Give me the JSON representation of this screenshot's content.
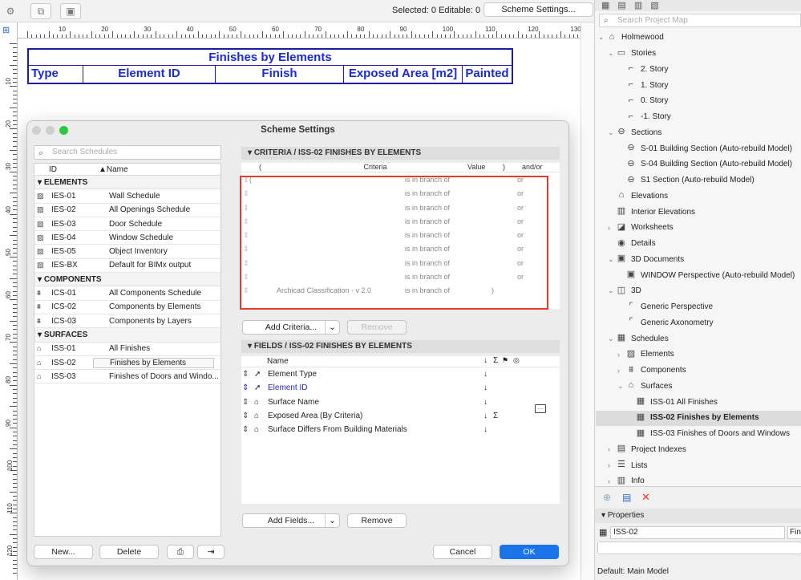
{
  "toolbar": {
    "selection_info": "Selected: 0  Editable: 0",
    "scheme_settings_button": "Scheme Settings..."
  },
  "ruler": {
    "h_labels": [
      "10",
      "20",
      "30",
      "40",
      "50",
      "60",
      "70",
      "80",
      "90",
      "100",
      "110",
      "120",
      "130"
    ],
    "v_labels": [
      "10",
      "20",
      "30",
      "40",
      "50",
      "60",
      "70",
      "80",
      "90",
      "100",
      "110",
      "120"
    ]
  },
  "schedule": {
    "title": "Finishes by Elements",
    "columns": [
      "Type",
      "Element ID",
      "Finish",
      "Exposed Area  [m2]",
      "Painted"
    ]
  },
  "dialog": {
    "title": "Scheme Settings",
    "search_placeholder": "Search Schedules",
    "list_header_id": "ID",
    "list_header_name": "▲Name",
    "groups": [
      {
        "label": "ELEMENTS",
        "icon": "hatch-icon",
        "items": [
          {
            "id": "IES-01",
            "name": "Wall Schedule"
          },
          {
            "id": "IES-02",
            "name": "All Openings Schedule"
          },
          {
            "id": "IES-03",
            "name": "Door Schedule"
          },
          {
            "id": "IES-04",
            "name": "Window Schedule"
          },
          {
            "id": "IES-05",
            "name": "Object Inventory"
          },
          {
            "id": "IES-BX",
            "name": "Default for BIMx output"
          }
        ]
      },
      {
        "label": "COMPONENTS",
        "icon": "component-icon",
        "items": [
          {
            "id": "ICS-01",
            "name": "All Components Schedule"
          },
          {
            "id": "ICS-02",
            "name": "Components by Elements"
          },
          {
            "id": "ICS-03",
            "name": "Components by Layers"
          }
        ]
      },
      {
        "label": "SURFACES",
        "icon": "surface-brush-icon",
        "items": [
          {
            "id": "ISS-01",
            "name": "All Finishes"
          },
          {
            "id": "ISS-02",
            "name": "Finishes by Elements",
            "selected": true
          },
          {
            "id": "ISS-03",
            "name": "Finishes of Doors and Windo..."
          }
        ]
      }
    ],
    "buttons": {
      "new": "New...",
      "delete": "Delete",
      "cancel": "Cancel",
      "ok": "OK"
    },
    "criteria": {
      "section_title": "CRITERIA / ISS-02 FINISHES BY ELEMENTS",
      "headers": {
        "open": "(",
        "criteria": "Criteria",
        "value": "Value",
        "close": ")",
        "andor": "and/or"
      },
      "rows": [
        {
          "open": "(",
          "criteria": "",
          "op": "is in branch of",
          "close": "",
          "andor": "or"
        },
        {
          "open": "",
          "criteria": "",
          "op": "is in branch of",
          "close": "",
          "andor": "or"
        },
        {
          "open": "",
          "criteria": "",
          "op": "is in branch of",
          "close": "",
          "andor": "or"
        },
        {
          "open": "",
          "criteria": "",
          "op": "is in branch of",
          "close": "",
          "andor": "or"
        },
        {
          "open": "",
          "criteria": "",
          "op": "is in branch of",
          "close": "",
          "andor": "or"
        },
        {
          "open": "",
          "criteria": "",
          "op": "is in branch of",
          "close": "",
          "andor": "or"
        },
        {
          "open": "",
          "criteria": "",
          "op": "is in branch of",
          "close": "",
          "andor": "or"
        },
        {
          "open": "",
          "criteria": "",
          "op": "is in branch of",
          "close": "",
          "andor": "or"
        },
        {
          "open": "",
          "criteria": "Archicad Classification - v 2.0",
          "op": "is in branch of",
          "close": ")",
          "andor": ""
        }
      ],
      "add_button": "Add Criteria...",
      "remove_button": "Remove"
    },
    "fields": {
      "section_title": "FIELDS / ISS-02 FINISHES BY ELEMENTS",
      "header_name": "Name",
      "header_sort": "↓",
      "header_sum": "Σ",
      "rows": [
        {
          "name": "Element Type",
          "icon": "cursor-icon",
          "sort": "↓",
          "sum": "",
          "highlight": false
        },
        {
          "name": "Element ID",
          "icon": "cursor-icon",
          "sort": "↓",
          "sum": "",
          "highlight": true
        },
        {
          "name": "Surface Name",
          "icon": "surface-brush-icon",
          "sort": "↓",
          "sum": "",
          "highlight": false
        },
        {
          "name": "Exposed Area (By Criteria)",
          "icon": "surface-brush-icon",
          "sort": "↓",
          "sum": "Σ",
          "highlight": false
        },
        {
          "name": "Surface Differs From Building Materials",
          "icon": "surface-brush-icon",
          "sort": "↓",
          "sum": "",
          "highlight": false
        }
      ],
      "add_button": "Add Fields...",
      "remove_button": "Remove"
    }
  },
  "project_map": {
    "search_placeholder": "Search Project Map",
    "nodes": [
      {
        "label": "Holmewood",
        "level": 0,
        "chev": "⌄",
        "icon": "house-icon"
      },
      {
        "label": "Stories",
        "level": 1,
        "chev": "⌄",
        "icon": "folder-icon"
      },
      {
        "label": "2. Story",
        "level": 2,
        "chev": "",
        "icon": "story-icon"
      },
      {
        "label": "1. Story",
        "level": 2,
        "chev": "",
        "icon": "story-icon"
      },
      {
        "label": "0. Story",
        "level": 2,
        "chev": "",
        "icon": "story-icon"
      },
      {
        "label": "-1. Story",
        "level": 2,
        "chev": "",
        "icon": "story-icon"
      },
      {
        "label": "Sections",
        "level": 1,
        "chev": "⌄",
        "icon": "section-icon"
      },
      {
        "label": "S-01 Building Section (Auto-rebuild Model)",
        "level": 2,
        "chev": "",
        "icon": "section-icon"
      },
      {
        "label": "S-04 Building Section (Auto-rebuild Model)",
        "level": 2,
        "chev": "",
        "icon": "section-icon"
      },
      {
        "label": "S1 Section (Auto-rebuild Model)",
        "level": 2,
        "chev": "",
        "icon": "section-icon"
      },
      {
        "label": "Elevations",
        "level": 1,
        "chev": "",
        "icon": "elevation-icon"
      },
      {
        "label": "Interior Elevations",
        "level": 1,
        "chev": "",
        "icon": "interior-elevation-icon"
      },
      {
        "label": "Worksheets",
        "level": 1,
        "chev": "›",
        "icon": "worksheet-icon"
      },
      {
        "label": "Details",
        "level": 1,
        "chev": "",
        "icon": "details-icon"
      },
      {
        "label": "3D Documents",
        "level": 1,
        "chev": "⌄",
        "icon": "3d-document-icon"
      },
      {
        "label": "WINDOW Perspective (Auto-rebuild Model)",
        "level": 2,
        "chev": "",
        "icon": "3d-document-icon"
      },
      {
        "label": "3D",
        "level": 1,
        "chev": "⌄",
        "icon": "cube-icon"
      },
      {
        "label": "Generic Perspective",
        "level": 2,
        "chev": "",
        "icon": "perspective-icon"
      },
      {
        "label": "Generic Axonometry",
        "level": 2,
        "chev": "",
        "icon": "axonometry-icon"
      },
      {
        "label": "Schedules",
        "level": 1,
        "chev": "⌄",
        "icon": "schedule-icon"
      },
      {
        "label": "Elements",
        "level": 2,
        "chev": "›",
        "icon": "hatch-icon"
      },
      {
        "label": "Components",
        "level": 2,
        "chev": "›",
        "icon": "component-icon"
      },
      {
        "label": "Surfaces",
        "level": 2,
        "chev": "⌄",
        "icon": "surface-brush-icon"
      },
      {
        "label": "ISS-01 All Finishes",
        "level": 3,
        "chev": "",
        "icon": "schedule-icon"
      },
      {
        "label": "ISS-02 Finishes by Elements",
        "level": 3,
        "chev": "",
        "icon": "schedule-icon",
        "selected": true
      },
      {
        "label": "ISS-03 Finishes of Doors and Windows",
        "level": 3,
        "chev": "",
        "icon": "schedule-icon"
      },
      {
        "label": "Project Indexes",
        "level": 1,
        "chev": "›",
        "icon": "index-icon"
      },
      {
        "label": "Lists",
        "level": 1,
        "chev": "›",
        "icon": "list-icon"
      },
      {
        "label": "Info",
        "level": 1,
        "chev": "›",
        "icon": "info-icon"
      }
    ],
    "properties_label": "Properties",
    "properties_id": "ISS-02",
    "properties_extra": "Fin",
    "default_model": "Default: Main Model"
  },
  "colors": {
    "schedule_blue": "#1a2bd6",
    "ok_blue": "#1a73e8",
    "highlight_red": "#e53b2c",
    "traffic_green": "#2ac840"
  }
}
